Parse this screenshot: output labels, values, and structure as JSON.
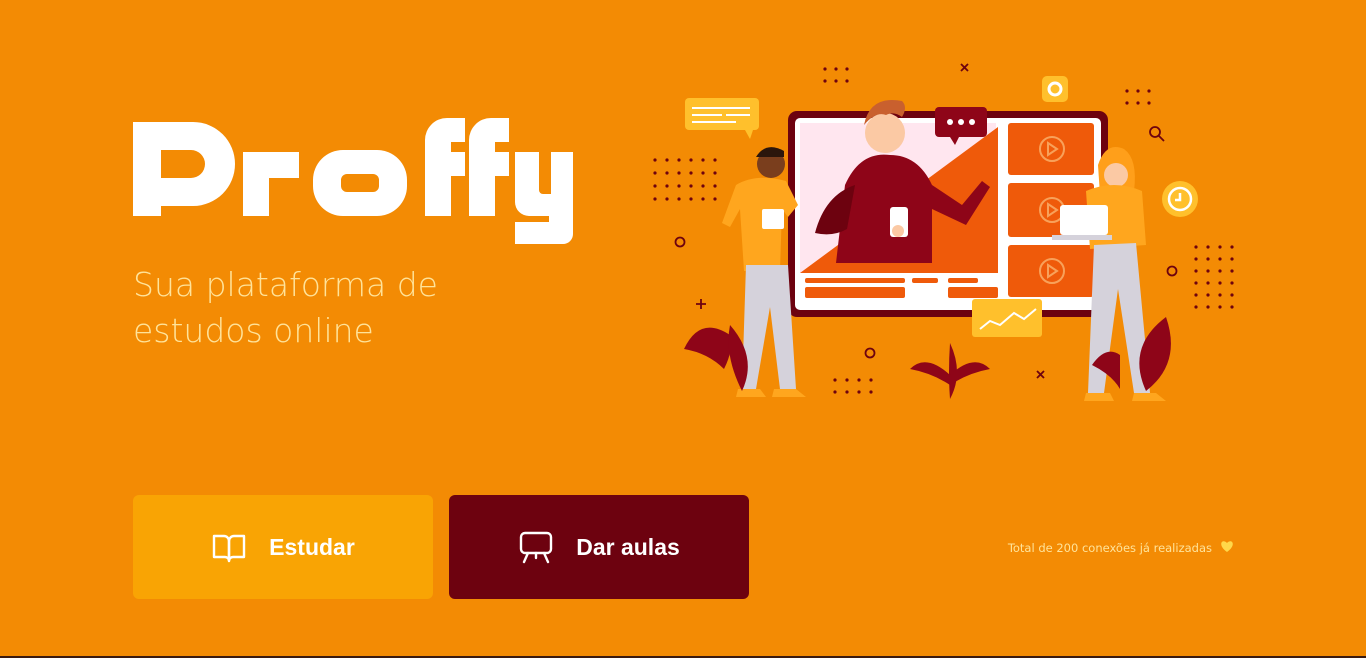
{
  "brand": {
    "logo_text": "Proffy"
  },
  "hero": {
    "tagline": "Sua plataforma de estudos online"
  },
  "actions": {
    "study_label": "Estudar",
    "teach_label": "Dar aulas"
  },
  "footer": {
    "total_connections": "Total de 200 conexões já realizadas"
  },
  "icons": {
    "study": "book-open-icon",
    "teach": "presentation-board-icon",
    "heart": "heart-icon"
  },
  "colors": {
    "background": "#F38B04",
    "study_button": "#F9A404",
    "teach_button": "#6D020F",
    "tagline": "#FFE39A"
  }
}
